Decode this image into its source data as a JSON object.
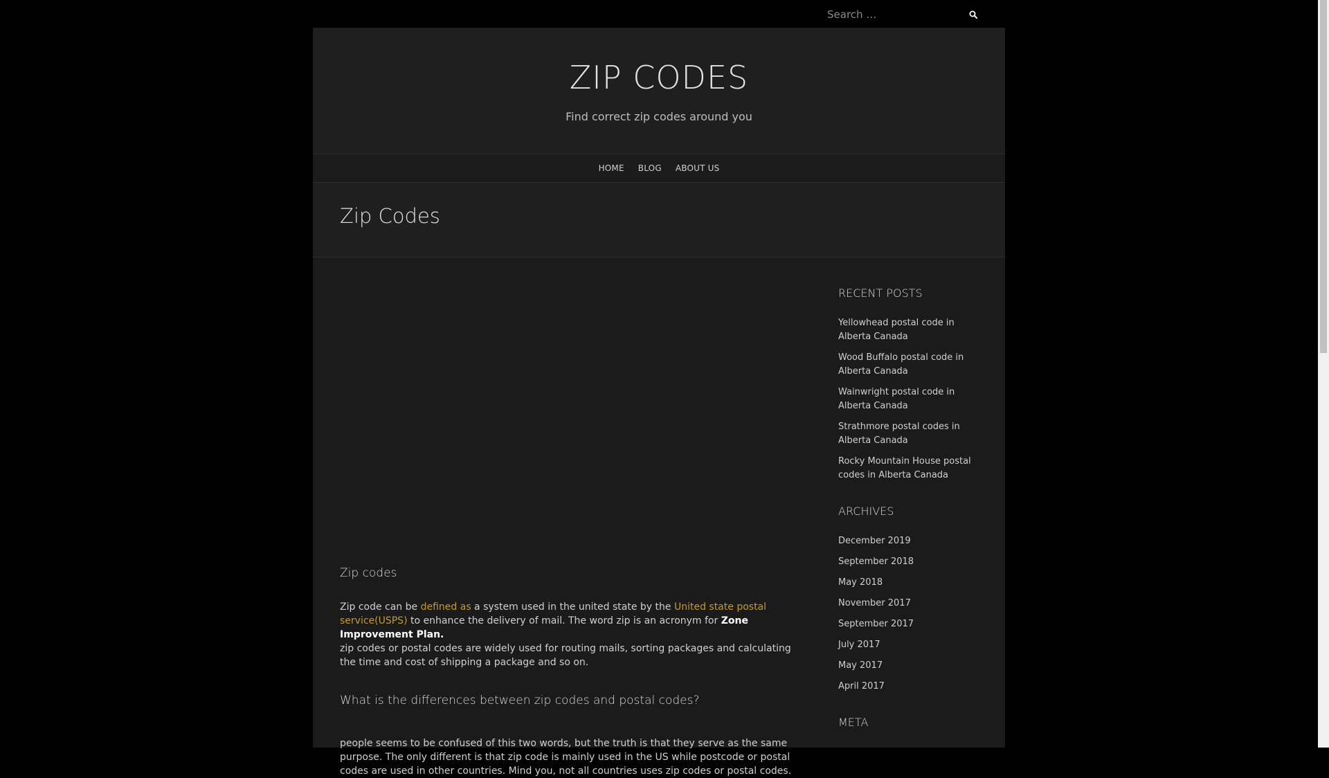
{
  "search": {
    "placeholder": "Search …"
  },
  "site": {
    "title": "ZIP CODES",
    "tagline": "Find correct zip codes around you"
  },
  "nav": {
    "items": [
      "HOME",
      "BLOG",
      "ABOUT US"
    ]
  },
  "page": {
    "title": "Zip Codes"
  },
  "content": {
    "heading1": "Zip codes",
    "p1_before_link1": "Zip code can be ",
    "p1_link1": "defined as",
    "p1_between_links": " a system used in the united state by the ",
    "p1_link2": "United state postal service(USPS)",
    "p1_after_link2": " to enhance the delivery of mail. The word zip is an acronym for ",
    "p1_bold": "Zone Improvement Plan.",
    "p1_line2": "zip codes or postal codes are widely used for routing mails, sorting packages and calculating the time and cost of shipping a package and so on.",
    "heading2": "What is the differences between zip codes and postal codes?",
    "p2": "people seems to be confused of this two words, but the truth is that they serve as the same purpose. The only different is that zip code is mainly used in the US while postcode or postal codes are used in other countries. Mind you, not all countries uses zip codes or postal codes."
  },
  "sidebar": {
    "recent_title": "RECENT POSTS",
    "recent_posts": [
      "Yellowhead postal code in Alberta Canada",
      "Wood Buffalo postal code in Alberta Canada",
      "Wainwright postal code in Alberta Canada",
      "Strathmore postal codes in Alberta Canada",
      "Rocky Mountain House postal codes in Alberta Canada"
    ],
    "archives_title": "ARCHIVES",
    "archives": [
      "December 2019",
      "September 2018",
      "May 2018",
      "November 2017",
      "September 2017",
      "July 2017",
      "May 2017",
      "April 2017"
    ],
    "meta_title": "META"
  },
  "icons": {
    "search": "search-icon"
  },
  "colors": {
    "background": "#000000",
    "page": "#1b1b1b",
    "link_accent": "#c4993a"
  }
}
